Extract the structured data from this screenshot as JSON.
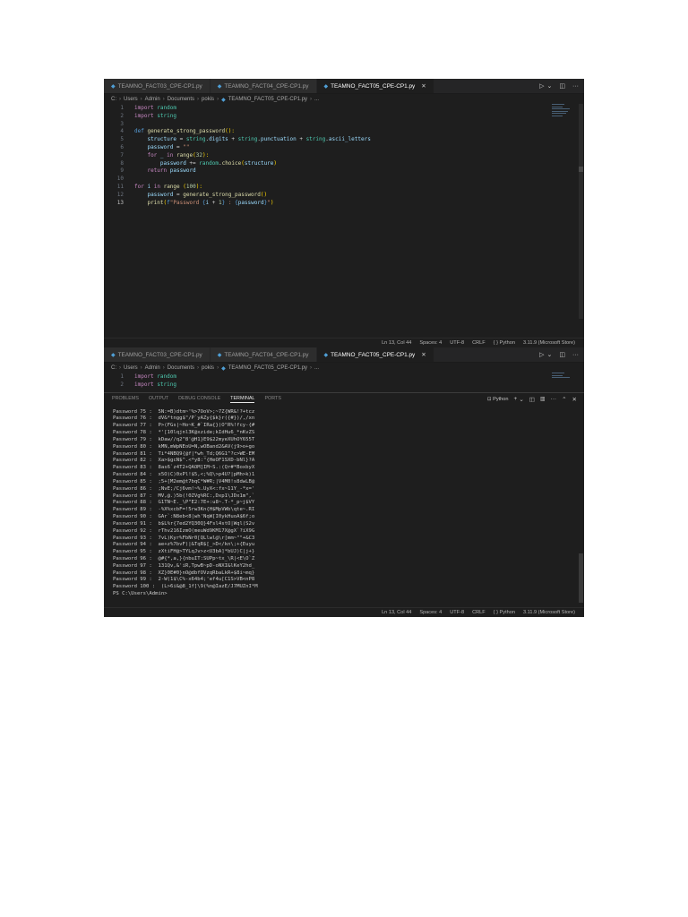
{
  "tabs": [
    {
      "label": "TEAMNO_FACT03_CPE-CP1.py",
      "active": false
    },
    {
      "label": "TEAMNO_FACT04_CPE-CP1.py",
      "active": false
    },
    {
      "label": "TEAMNO_FACT05_CPE-CP1.py",
      "active": true
    }
  ],
  "tab_close": "✕",
  "tab_actions": {
    "run": "▷",
    "run_menu": "⌄",
    "split": "◫",
    "more": "···"
  },
  "breadcrumb": {
    "parts": [
      "C:",
      "Users",
      "Admin",
      "Documents",
      "pokis"
    ],
    "file": "TEAMNO_FACT05_CPE-CP1.py",
    "tail": "..."
  },
  "code_lines": [
    {
      "n": "1",
      "segments": [
        {
          "t": "import",
          "c": "kw2"
        },
        {
          "t": " "
        },
        {
          "t": "random",
          "c": "mod"
        }
      ]
    },
    {
      "n": "2",
      "segments": [
        {
          "t": "import",
          "c": "kw2"
        },
        {
          "t": " "
        },
        {
          "t": "string",
          "c": "mod"
        }
      ]
    },
    {
      "n": "3",
      "segments": []
    },
    {
      "n": "4",
      "segments": [
        {
          "t": "def",
          "c": "kw"
        },
        {
          "t": " "
        },
        {
          "t": "generate_strong_password",
          "c": "fn"
        },
        {
          "t": "():",
          "c": "br1"
        }
      ]
    },
    {
      "n": "5",
      "segments": [
        {
          "t": "    "
        },
        {
          "t": "structure",
          "c": "var"
        },
        {
          "t": " = "
        },
        {
          "t": "string",
          "c": "mod"
        },
        {
          "t": "."
        },
        {
          "t": "digits",
          "c": "var"
        },
        {
          "t": " + "
        },
        {
          "t": "string",
          "c": "mod"
        },
        {
          "t": "."
        },
        {
          "t": "punctuation",
          "c": "var"
        },
        {
          "t": " + "
        },
        {
          "t": "string",
          "c": "mod"
        },
        {
          "t": "."
        },
        {
          "t": "ascii_letters",
          "c": "var"
        }
      ]
    },
    {
      "n": "6",
      "segments": [
        {
          "t": "    "
        },
        {
          "t": "password",
          "c": "var"
        },
        {
          "t": " = "
        },
        {
          "t": "\"\"",
          "c": "str"
        }
      ]
    },
    {
      "n": "7",
      "segments": [
        {
          "t": "    "
        },
        {
          "t": "for",
          "c": "kw2"
        },
        {
          "t": " "
        },
        {
          "t": "_",
          "c": "var"
        },
        {
          "t": " "
        },
        {
          "t": "in",
          "c": "kw2"
        },
        {
          "t": " "
        },
        {
          "t": "range",
          "c": "fn"
        },
        {
          "t": "(",
          "c": "br1"
        },
        {
          "t": "32",
          "c": "num"
        },
        {
          "t": "):",
          "c": "br1"
        }
      ]
    },
    {
      "n": "8",
      "segments": [
        {
          "t": "        "
        },
        {
          "t": "password",
          "c": "var"
        },
        {
          "t": " += "
        },
        {
          "t": "random",
          "c": "mod"
        },
        {
          "t": "."
        },
        {
          "t": "choice",
          "c": "fn"
        },
        {
          "t": "(",
          "c": "br1"
        },
        {
          "t": "structure",
          "c": "var"
        },
        {
          "t": ")",
          "c": "br1"
        }
      ]
    },
    {
      "n": "9",
      "segments": [
        {
          "t": "    "
        },
        {
          "t": "return",
          "c": "kw2"
        },
        {
          "t": " "
        },
        {
          "t": "password",
          "c": "var"
        }
      ]
    },
    {
      "n": "10",
      "segments": []
    },
    {
      "n": "11",
      "segments": [
        {
          "t": "for",
          "c": "kw2"
        },
        {
          "t": " "
        },
        {
          "t": "i",
          "c": "var"
        },
        {
          "t": " "
        },
        {
          "t": "in",
          "c": "kw2"
        },
        {
          "t": " "
        },
        {
          "t": "range",
          "c": "fn"
        },
        {
          "t": " "
        },
        {
          "t": "(",
          "c": "br1"
        },
        {
          "t": "100",
          "c": "num"
        },
        {
          "t": "):",
          "c": "br1"
        }
      ]
    },
    {
      "n": "12",
      "segments": [
        {
          "t": "    "
        },
        {
          "t": "password",
          "c": "var"
        },
        {
          "t": " = "
        },
        {
          "t": "generate_strong_password",
          "c": "fn"
        },
        {
          "t": "()",
          "c": "br1"
        }
      ]
    },
    {
      "n": "13",
      "current": true,
      "segments": [
        {
          "t": "    "
        },
        {
          "t": "print",
          "c": "fn"
        },
        {
          "t": "(",
          "c": "br1"
        },
        {
          "t": "f",
          "c": "kw"
        },
        {
          "t": "\"Password ",
          "c": "str"
        },
        {
          "t": "{",
          "c": "kw"
        },
        {
          "t": "i",
          "c": "var"
        },
        {
          "t": " + "
        },
        {
          "t": "1",
          "c": "num"
        },
        {
          "t": "}",
          "c": "kw"
        },
        {
          "t": " : ",
          "c": "str"
        },
        {
          "t": "{",
          "c": "kw"
        },
        {
          "t": "password",
          "c": "var"
        },
        {
          "t": "}",
          "c": "kw"
        },
        {
          "t": "\"",
          "c": "str"
        },
        {
          "t": ")",
          "c": "br1"
        }
      ]
    }
  ],
  "statusbar": {
    "position": "Ln 13, Col 44",
    "spaces": "Spaces: 4",
    "encoding": "UTF-8",
    "eol": "CRLF",
    "language": "{ } Python",
    "interpreter": "3.11.9 (Microsoft Store)"
  },
  "panel": {
    "tabs": [
      "PROBLEMS",
      "OUTPUT",
      "DEBUG CONSOLE",
      "TERMINAL",
      "PORTS"
    ],
    "active": "TERMINAL",
    "shell_label": "Python",
    "actions": {
      "add": "+",
      "add_menu": "⌄",
      "split": "◫",
      "trash": "🗑",
      "more": "···",
      "maximize": "⌃",
      "close": "✕"
    }
  },
  "terminal_lines": [
    "Password 75 :  5N:=B)dtm~'%>7OoV>;~7Z{WR&!?+tcz",
    "Password 76 :  dV&*tngg$\"/P`yAZy{$k}r({#})/,/xn",
    "Password 77 :  P>(FGs|~Ho~K_#`IRa{})O\"R%!fcy-{#",
    "Password 78 :  *'[10lqjnl3K@xzide;kIdHu6_*nKvZS",
    "Password 79 :  kDaw//q2^8'@H1}E9$22myeXUhOY655T",
    "Password 80 :  kMN,mWpNEoU=N,wOBand2&AV(j9>o+go",
    "Password 81 :  Ti*4NBQ9{@f|*wh_Td;Q6G1^?c>WE-EM",
    "Password 82 :  Xa>$gcN$^.<*y8:\"{HeOF1SXD-bNl}?A",
    "Password 83 :  8as6`z4T2+QAOM]IM~S.:(Qr#*BoxbyX",
    "Password 84 :  x5O)C)0xPl!$5,<;%Q\\>p4U?|pMh>k)1",
    "Password 85 :  ;5+[M2em@t7bqC*W#R;|V4M0!s8dwLB@",
    "Password 86 :  ;NvE;/Cj6vm!~%.UyX<:fx~11Y_-*x='",
    "Password 87 :  MV,@.)5b(!0ZVg%RC:,Dxp1\\JDx1m\",`",
    "Password 88 :  G1TN~E._\\P\"E2:7E+:u8~.T-*_p~j$VY",
    "Password 89 :  -%X%xcbF=!5rw3Kn{H$MpVWb\\qte~.RI",
    "Password 90 :  GAr`:N8eb<8|wh'NqW[I0ykHuoA$6f;o",
    "Password 91 :  b$L%r{7ed2YQ30Q}4Fsl4stO|Wql(S2v",
    "Password 92 :  rThv216IzmO(meuWd9KM17X@gX`?iX9G",
    "Password 93 :  7vL)Kyr%FbNr0[QLlwl@\\r[mm~\"\"+&C3",
    "Password 94 :  ae+z%7bvF)|&TqR$[_>D</kn\\;+{Euyu",
    "Password 95 :  zXtiFH@>TYLqJv>z<U3bA]*bUJ)C|j+}",
    "Password 96 :  @#{*,a,}{nbuIT:SUPp~tx_\\R|<E\\O`Z",
    "Password 97 :  131Qv,&'iR,TpwB~pD-oNXI&lKeY2hd_",
    "Password 98 :  XZ}0E#0}nO@dbfOVzqRbaLkR+$8i~mq}",
    "Password 99 :  2-W(1$\\C%-x64b4;'ef4u[C1S>VB<nP8",
    "Password 100 :  (L>6i&@8_1f]\\9(%n@IazE/J7MUZnI*M",
    "PS C:\\Users\\Admin>"
  ],
  "terminal_short_code": [
    {
      "n": "1",
      "segments": [
        {
          "t": "import",
          "c": "kw2"
        },
        {
          "t": " "
        },
        {
          "t": "random",
          "c": "mod"
        }
      ]
    },
    {
      "n": "2",
      "segments": [
        {
          "t": "import",
          "c": "kw2"
        },
        {
          "t": " "
        },
        {
          "t": "string",
          "c": "mod"
        }
      ]
    }
  ]
}
